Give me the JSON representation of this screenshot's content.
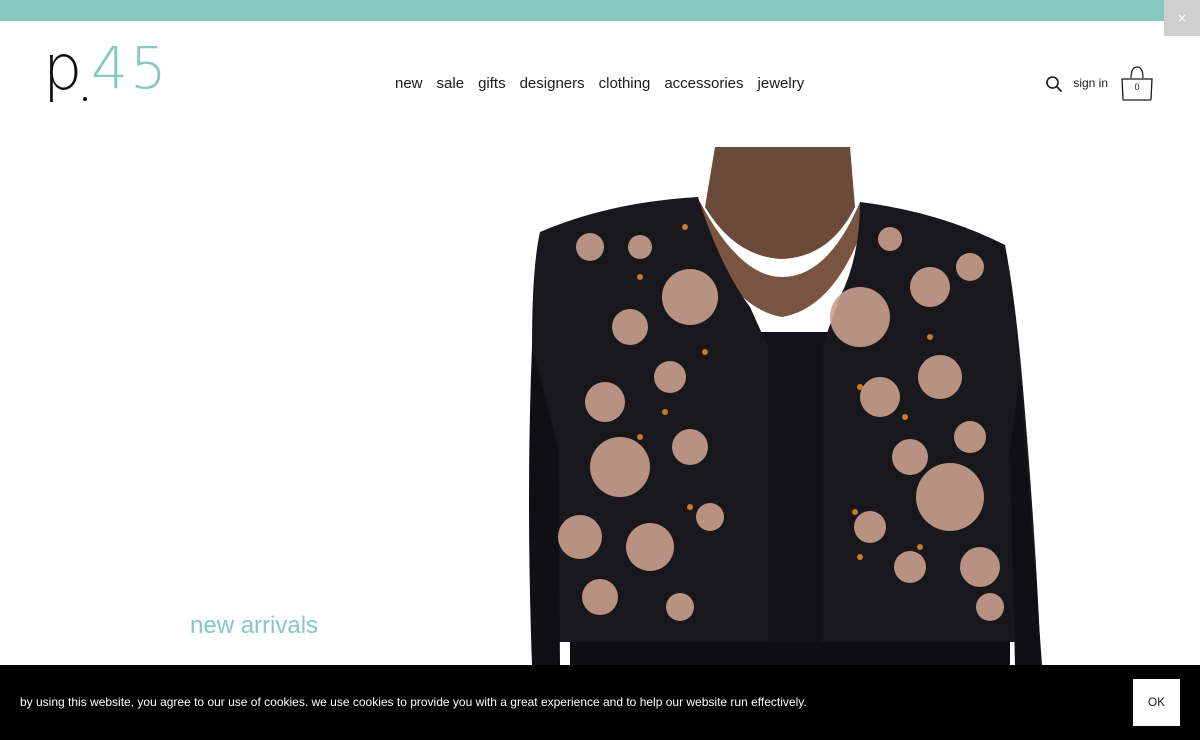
{
  "topbar": {
    "close_label": "×"
  },
  "logo": {
    "letter": "p",
    "number": "45"
  },
  "nav": {
    "items": [
      {
        "label": "new"
      },
      {
        "label": "sale"
      },
      {
        "label": "gifts"
      },
      {
        "label": "designers"
      },
      {
        "label": "clothing"
      },
      {
        "label": "accessories"
      },
      {
        "label": "jewelry"
      }
    ]
  },
  "header": {
    "signin_label": "sign in",
    "cart_count": "0",
    "search_icon": "search-icon",
    "cart_icon": "shopping-bag-icon"
  },
  "hero": {
    "title": "new arrivals",
    "image_alt": "model wearing black cropped jacket with rose-gold floral embroidery"
  },
  "cookie": {
    "text": "by using this website, you agree to our use of cookies. we use cookies to provide you with a great experience and to help our website run effectively.",
    "ok_label": "OK"
  },
  "colors": {
    "accent": "#86c8bf",
    "cookie_bg": "#000000",
    "text": "#1a1a1a"
  }
}
